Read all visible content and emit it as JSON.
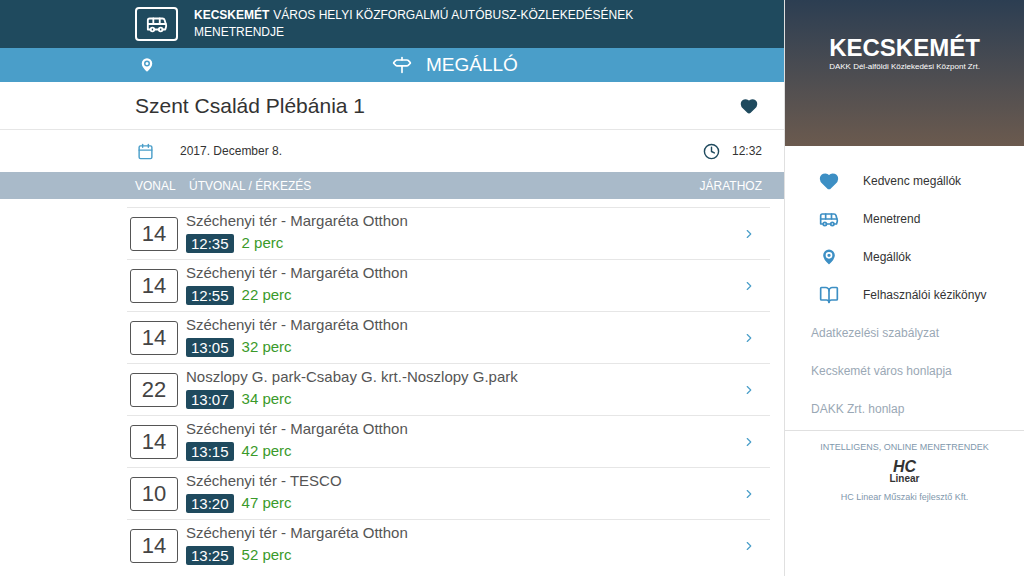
{
  "header": {
    "title_bold": "KECSKEMÉT",
    "title_rest": "VÁROS HELYI KÖZFORGALMÚ AUTÓBUSZ-KÖZLEKEDÉSÉNEK",
    "subtitle": "MENETRENDJE"
  },
  "nav_bar": {
    "title": "MEGÁLLÓ"
  },
  "stop": {
    "name": "Szent Család Plébánia 1",
    "favorite": true,
    "date": "2017. December 8.",
    "time": "12:32"
  },
  "columns": [
    "VONAL",
    "ÚTVONAL / ÉRKEZÉS",
    "JÁRATHOZ"
  ],
  "departures": [
    {
      "line": "14",
      "route": "Széchenyi tér - Margaréta Otthon",
      "time": "12:35",
      "wait": "2 perc"
    },
    {
      "line": "14",
      "route": "Széchenyi tér - Margaréta Otthon",
      "time": "12:55",
      "wait": "22 perc"
    },
    {
      "line": "14",
      "route": "Széchenyi tér - Margaréta Otthon",
      "time": "13:05",
      "wait": "32 perc"
    },
    {
      "line": "22",
      "route": "Noszlopy G. park-Csabay G. krt.-Noszlopy G.park",
      "time": "13:07",
      "wait": "34 perc"
    },
    {
      "line": "14",
      "route": "Széchenyi tér - Margaréta Otthon",
      "time": "13:15",
      "wait": "42 perc"
    },
    {
      "line": "10",
      "route": "Széchenyi tér - TESCO",
      "time": "13:20",
      "wait": "47 perc"
    },
    {
      "line": "14",
      "route": "Széchenyi tér - Margaréta Otthon",
      "time": "13:25",
      "wait": "52 perc"
    }
  ],
  "sidebar": {
    "banner": {
      "title": "KECSKEMÉT",
      "subtitle": "DAKK Dél-alföldi Közlekedési Központ Zrt."
    },
    "menu": [
      {
        "label": "Kedvenc megállók",
        "kind": "heart"
      },
      {
        "label": "Menetrend",
        "kind": "bus"
      },
      {
        "label": "Megállók",
        "kind": "pin"
      },
      {
        "label": "Felhasználói kézikönyv",
        "kind": "book"
      }
    ],
    "links": [
      "Adatkezelési szabályzat",
      "Kecskemét város honlapja",
      "DAKK Zrt. honlap"
    ],
    "footer": {
      "tagline": "INTELLIGENS, ONLINE MENETRENDEK",
      "logo_top": "HC",
      "logo_bottom": "Linear",
      "company": "HC Linear Műszaki fejlesztő Kft."
    }
  }
}
